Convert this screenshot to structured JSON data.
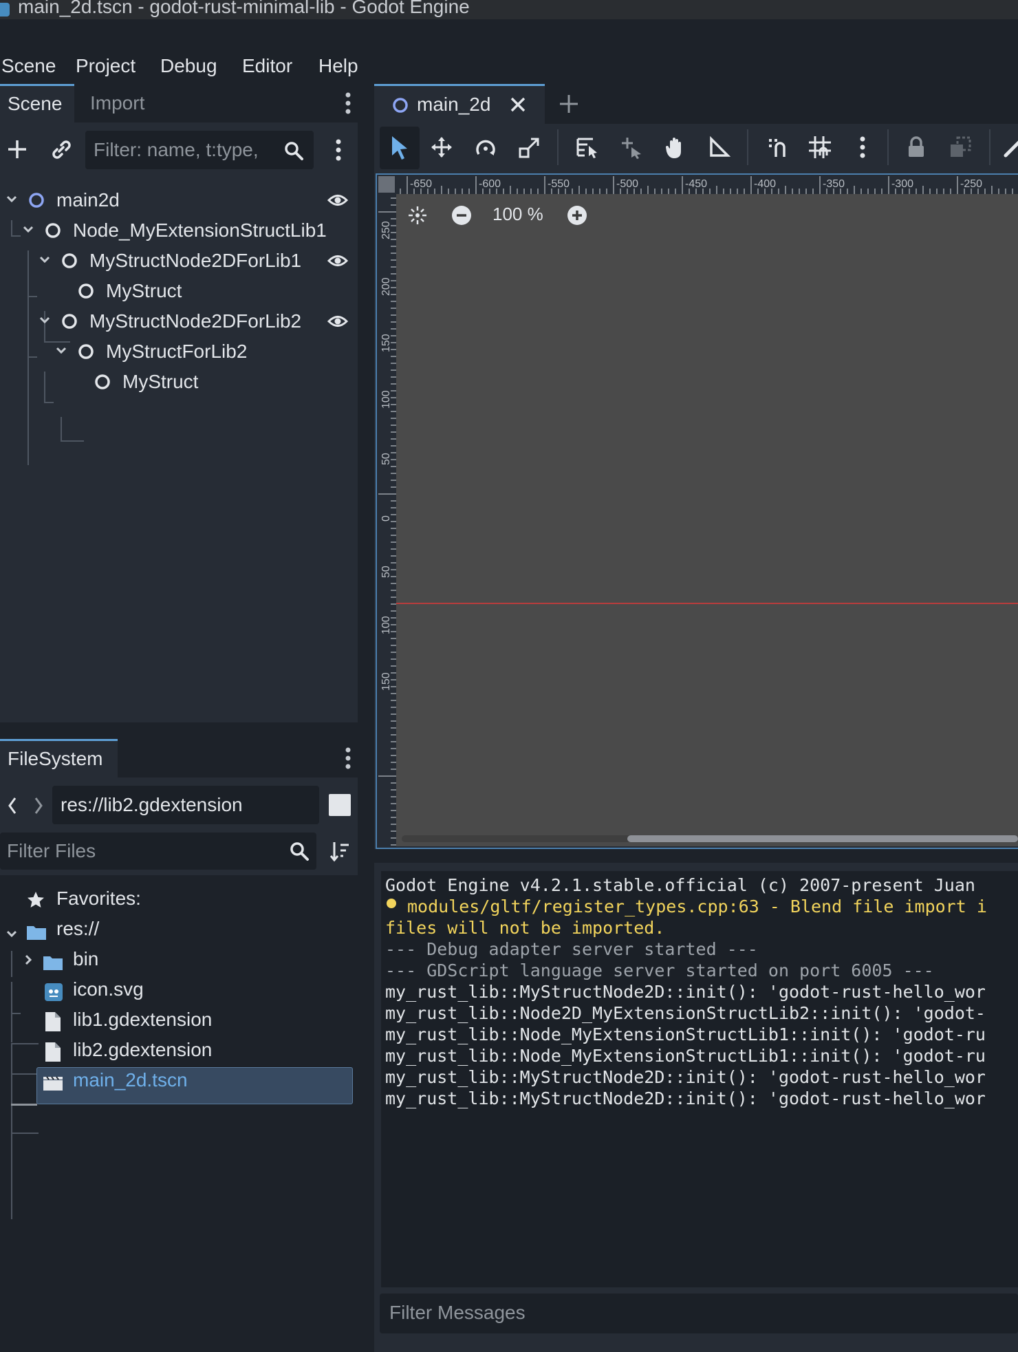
{
  "window": {
    "title": "main_2d.tscn - godot-rust-minimal-lib - Godot Engine"
  },
  "menu": [
    "Scene",
    "Project",
    "Debug",
    "Editor",
    "Help"
  ],
  "scene_dock": {
    "tabs": [
      "Scene",
      "Import"
    ],
    "filter_placeholder": "Filter: name, t:type,",
    "tree": [
      {
        "label": "main2d",
        "visible_icon": true
      },
      {
        "label": "Node_MyExtensionStructLib1"
      },
      {
        "label": "MyStructNode2DForLib1",
        "visible_icon": true
      },
      {
        "label": "MyStruct"
      },
      {
        "label": "MyStructNode2DForLib2",
        "visible_icon": true
      },
      {
        "label": "MyStructForLib2"
      },
      {
        "label": "MyStruct"
      }
    ]
  },
  "filesystem": {
    "tab": "FileSystem",
    "path": "res://lib2.gdextension",
    "filter_placeholder": "Filter Files",
    "items": [
      {
        "label": "Favorites:"
      },
      {
        "label": "res://"
      },
      {
        "label": "bin"
      },
      {
        "label": "icon.svg"
      },
      {
        "label": "lib1.gdextension"
      },
      {
        "label": "lib2.gdextension",
        "selected": true
      },
      {
        "label": "main_2d.tscn"
      }
    ]
  },
  "editor": {
    "tab_label": "main_2d",
    "zoom": "100 %",
    "ruler_top": [
      "-650",
      "-600",
      "-550",
      "-500",
      "-450",
      "-400",
      "-350",
      "-300",
      "-250"
    ],
    "ruler_left": [
      "250",
      "200",
      "150",
      "100",
      "50",
      "0",
      "50",
      "100",
      "150"
    ]
  },
  "output": {
    "lines": [
      {
        "text": "Godot Engine v4.2.1.stable.official (c) 2007-present Juan",
        "kind": "normal"
      },
      {
        "text": "modules/gltf/register_types.cpp:63 - Blend file import i",
        "kind": "warning"
      },
      {
        "text": "files will not be imported.",
        "kind": "warning"
      },
      {
        "text": "--- Debug adapter server started ---",
        "kind": "dim"
      },
      {
        "text": "--- GDScript language server started on port 6005 ---",
        "kind": "dim"
      },
      {
        "text": "my_rust_lib::MyStructNode2D::init(): 'godot-rust-hello_wor",
        "kind": "normal"
      },
      {
        "text": "my_rust_lib::Node2D_MyExtensionStructLib2::init(): 'godot-",
        "kind": "normal"
      },
      {
        "text": "my_rust_lib::Node_MyExtensionStructLib1::init(): 'godot-ru",
        "kind": "normal"
      },
      {
        "text": "my_rust_lib::Node_MyExtensionStructLib1::init(): 'godot-ru",
        "kind": "normal"
      },
      {
        "text": "my_rust_lib::MyStructNode2D::init(): 'godot-rust-hello_wor",
        "kind": "normal"
      },
      {
        "text": "my_rust_lib::MyStructNode2D::init(): 'godot-rust-hello_wor",
        "kind": "normal"
      }
    ],
    "filter_placeholder": "Filter Messages"
  },
  "colors": {
    "accent": "#5e9fd5",
    "warning": "#f2d45c",
    "node_ring_root": "#8da5f3",
    "scene_file_link": "#6fb0ea",
    "selected_row": "#374a61",
    "canvas_bg": "#4a4a4a",
    "y_axis_line": "#b93c3c"
  }
}
